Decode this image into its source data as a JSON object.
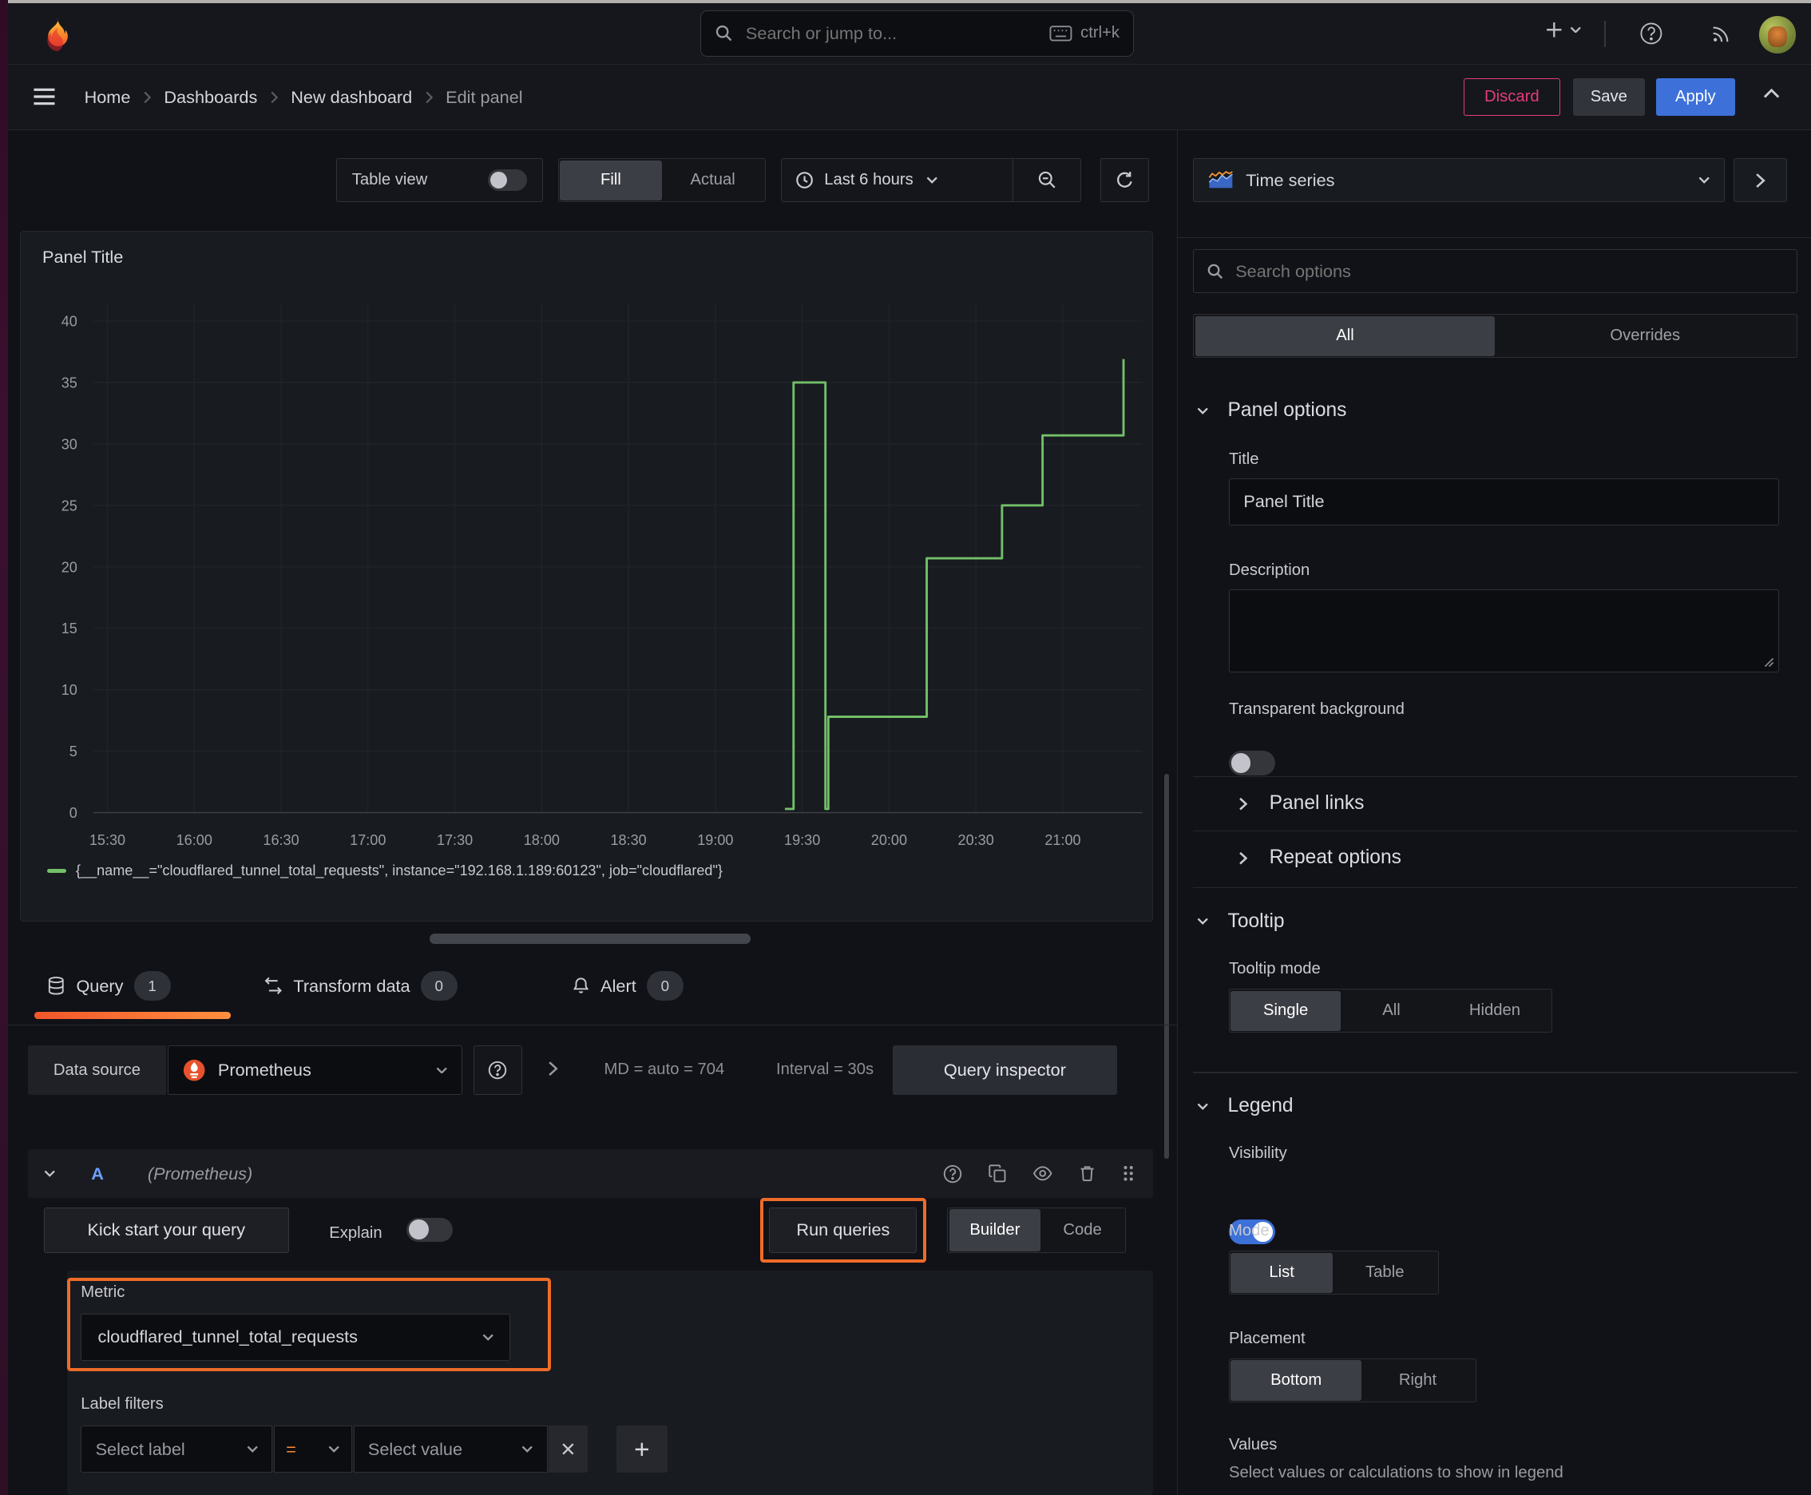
{
  "topnav": {
    "search_placeholder": "Search or jump to...",
    "search_shortcut": "ctrl+k"
  },
  "breadcrumb": {
    "items": [
      "Home",
      "Dashboards",
      "New dashboard",
      "Edit panel"
    ]
  },
  "header_actions": {
    "discard": "Discard",
    "save": "Save",
    "apply": "Apply"
  },
  "toolbar": {
    "table_view_label": "Table view",
    "view_modes": [
      "Fill",
      "Actual"
    ],
    "time_range": "Last 6 hours"
  },
  "panel": {
    "title": "Panel Title"
  },
  "chart_data": {
    "type": "line",
    "line_style": "step-after",
    "title": "Panel Title",
    "x_ticks": [
      "15:30",
      "16:00",
      "16:30",
      "17:00",
      "17:30",
      "18:00",
      "18:30",
      "19:00",
      "19:30",
      "20:00",
      "20:30",
      "21:00"
    ],
    "y_ticks": [
      0,
      5,
      10,
      15,
      20,
      25,
      30,
      35,
      40
    ],
    "ylim": [
      0,
      40
    ],
    "x_window": [
      "15:25",
      "21:21"
    ],
    "grid": true,
    "legend_position": "bottom",
    "series": [
      {
        "name": "{__name__=\"cloudflared_tunnel_total_requests\", instance=\"192.168.1.189:60123\", job=\"cloudflared\"}",
        "color": "#73bf69",
        "points": [
          {
            "t": "19:24",
            "v": 0.3
          },
          {
            "t": "19:27",
            "v": 35
          },
          {
            "t": "19:38",
            "v": 0.3
          },
          {
            "t": "19:39",
            "v": 7.8
          },
          {
            "t": "20:13",
            "v": 20.7
          },
          {
            "t": "20:39",
            "v": 25
          },
          {
            "t": "20:53",
            "v": 30.7
          },
          {
            "t": "21:21",
            "v": 36.9
          }
        ]
      }
    ]
  },
  "tabs": [
    {
      "label": "Query",
      "count": "1"
    },
    {
      "label": "Transform data",
      "count": "0"
    },
    {
      "label": "Alert",
      "count": "0"
    }
  ],
  "query_row": {
    "datasource_label": "Data source",
    "datasource_value": "Prometheus",
    "options_summary_md": "MD = auto = 704",
    "options_summary_interval": "Interval = 30s",
    "inspector_label": "Query inspector",
    "ref_id": "A",
    "ref_ds": "(Prometheus)",
    "kickstart_label": "Kick start your query",
    "explain_label": "Explain",
    "run_label": "Run queries",
    "editor_modes": [
      "Builder",
      "Code"
    ],
    "metric_label": "Metric",
    "metric_value": "cloudflared_tunnel_total_requests",
    "label_filters_label": "Label filters",
    "select_label_placeholder": "Select label",
    "operator": "=",
    "select_value_placeholder": "Select value"
  },
  "options_pane": {
    "visualization": "Time series",
    "search_placeholder": "Search options",
    "filter_tabs": [
      "All",
      "Overrides"
    ],
    "panel_options": {
      "heading": "Panel options",
      "title_label": "Title",
      "title_value": "Panel Title",
      "description_label": "Description",
      "transparent_label": "Transparent background",
      "links_label": "Panel links",
      "repeat_label": "Repeat options"
    },
    "tooltip": {
      "heading": "Tooltip",
      "mode_label": "Tooltip mode",
      "modes": [
        "Single",
        "All",
        "Hidden"
      ],
      "selected_mode": "Single"
    },
    "legend": {
      "heading": "Legend",
      "visibility_label": "Visibility",
      "mode_label": "Mode",
      "modes": [
        "List",
        "Table"
      ],
      "selected_mode": "List",
      "placement_label": "Placement",
      "placements": [
        "Bottom",
        "Right"
      ],
      "selected_placement": "Bottom",
      "values_label": "Values",
      "values_help": "Select values or calculations to show in legend"
    }
  },
  "colors": {
    "accent_blue": "#3d71d9",
    "tab_underline_from": "#f2562b",
    "tab_underline_to": "#ff8f3e",
    "series_green": "#73bf69",
    "discard_pink": "#e23d77",
    "annotation_orange": "#ee6c29"
  }
}
